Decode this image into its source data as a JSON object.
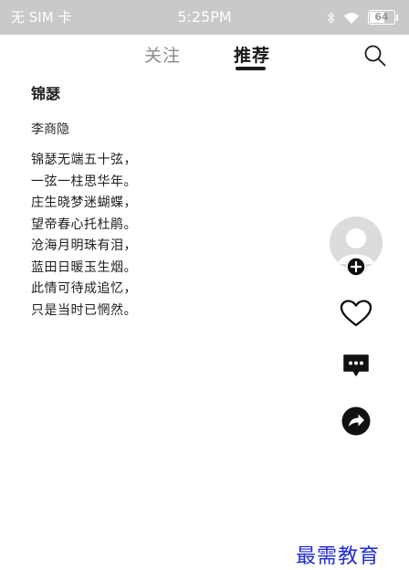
{
  "status_bar": {
    "carrier": "无 SIM 卡",
    "time": "5:25PM",
    "battery_level": "64",
    "battery_fraction": 0.64,
    "icons": [
      "bluetooth-icon",
      "wifi-icon",
      "battery-icon"
    ]
  },
  "nav": {
    "tabs": [
      {
        "label": "关注",
        "active": false
      },
      {
        "label": "推荐",
        "active": true
      }
    ],
    "search_icon": "search-icon"
  },
  "poem": {
    "title": "锦瑟",
    "author": "李商隐",
    "lines": [
      "锦瑟无端五十弦，",
      "一弦一柱思华年。",
      "庄生晓梦迷蝴蝶，",
      "望帝春心托杜鹃。",
      "沧海月明珠有泪，",
      "蓝田日暖玉生烟。",
      "此情可待成追忆，",
      "只是当时已惘然。"
    ]
  },
  "actions": {
    "avatar_icon": "avatar-icon",
    "follow_icon": "follow-plus-icon",
    "like_icon": "heart-icon",
    "comment_icon": "comment-icon",
    "share_icon": "share-icon"
  },
  "watermark": {
    "text": "最需教育",
    "color": "#1f2bd1"
  },
  "colors": {
    "status_bar_bg": "#c9c9c9",
    "text_primary": "#1e1e1e",
    "tab_inactive": "#8a8a8a"
  }
}
